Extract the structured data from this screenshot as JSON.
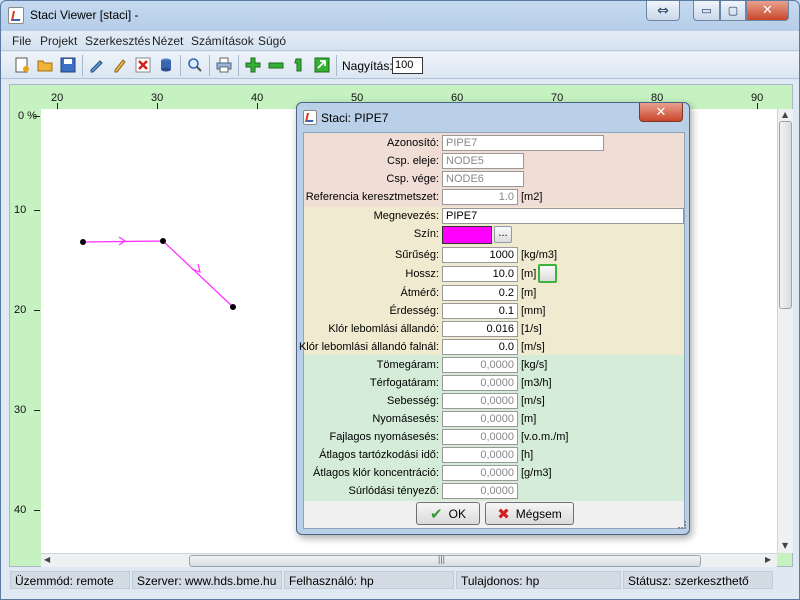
{
  "window": {
    "title": "Staci Viewer [staci]  -",
    "restore_doc_glyph": "⇔",
    "min_glyph": "▭",
    "max_glyph": "▢",
    "close_glyph": "✕"
  },
  "menu": [
    "File",
    "Projekt",
    "Szerkesztés",
    "Nézet",
    "Számítások",
    "Súgó"
  ],
  "toolbar": {
    "icons": [
      "new-file-icon",
      "open-folder-icon",
      "save-icon",
      "edit-icon",
      "pencil-icon",
      "delete-icon",
      "database-icon",
      "zoom-icon",
      "print-icon",
      "add-icon",
      "remove-icon",
      "pipe-icon",
      "export-icon"
    ],
    "zoom_label": "Nagyítás:",
    "zoom_value": "100"
  },
  "canvas": {
    "x_ticks": [
      "20",
      "30",
      "40",
      "50",
      "60",
      "70",
      "80",
      "90"
    ],
    "y_ticks": [
      "0 %",
      "10",
      "20",
      "30",
      "40"
    ],
    "line_color": "#ff33ff",
    "node_color": "#000000",
    "scroll_grip": "|||"
  },
  "status": {
    "mode": "Üzemmód: remote",
    "server": "Szerver: www.hds.bme.hu",
    "user": "Felhasználó: hp",
    "owner": "Tulajdonos: hp",
    "state": "Státusz: szerkeszthető"
  },
  "dialog": {
    "title": "Staci: PIPE7",
    "close_glyph": "✕",
    "id_label": "Azonosító:",
    "id_value": "PIPE7",
    "start_label": "Csp. eleje:",
    "start_value": "NODE5",
    "end_label": "Csp. vége:",
    "end_value": "NODE6",
    "ref_label": "Referencia keresztmetszet:",
    "ref_value": "1.0",
    "ref_unit": "[m2]",
    "name_label": "Megnevezés:",
    "name_value": "PIPE7",
    "color_label": "Szín:",
    "color_value": "#ff00ff",
    "dots": "...",
    "density_label": "Sűrűség:",
    "density_value": "1000",
    "density_unit": "[kg/m3]",
    "length_label": "Hossz:",
    "length_value": "10.0",
    "length_unit": "[m]",
    "diameter_label": "Átmérő:",
    "diameter_value": "0.2",
    "diameter_unit": "[m]",
    "roughness_label": "Érdesség:",
    "roughness_value": "0.1",
    "roughness_unit": "[mm]",
    "chlor_label": "Klór lebomlási állandó:",
    "chlor_value": "0.016",
    "chlor_unit": "[1/s]",
    "chlor_wall_label": "Klór lebomlási állandó falnál:",
    "chlor_wall_value": "0.0",
    "chlor_wall_unit": "[m/s]",
    "massflow_label": "Tömegáram:",
    "massflow_value": "0,0000",
    "massflow_unit": "[kg/s]",
    "volflow_label": "Térfogatáram:",
    "volflow_value": "0,0000",
    "volflow_unit": "[m3/h]",
    "velocity_label": "Sebesség:",
    "velocity_value": "0,0000",
    "velocity_unit": "[m/s]",
    "headloss_label": "Nyomásesés:",
    "headloss_value": "0,0000",
    "headloss_unit": "[m]",
    "spec_headloss_label": "Fajlagos nyomásesés:",
    "spec_headloss_value": "0,0000",
    "spec_headloss_unit": "[v.o.m./m]",
    "residence_label": "Átlagos tartózkodási idő:",
    "residence_value": "0,0000",
    "residence_unit": "[h]",
    "conc_label": "Átlagos klór koncentráció:",
    "conc_value": "0,0000",
    "conc_unit": "[g/m3]",
    "friction_label": "Súrlódási tényező:",
    "friction_value": "0,0000",
    "ok_label": "OK",
    "cancel_label": "Mégsem",
    "check_glyph": "✔",
    "x_glyph": "✖"
  }
}
